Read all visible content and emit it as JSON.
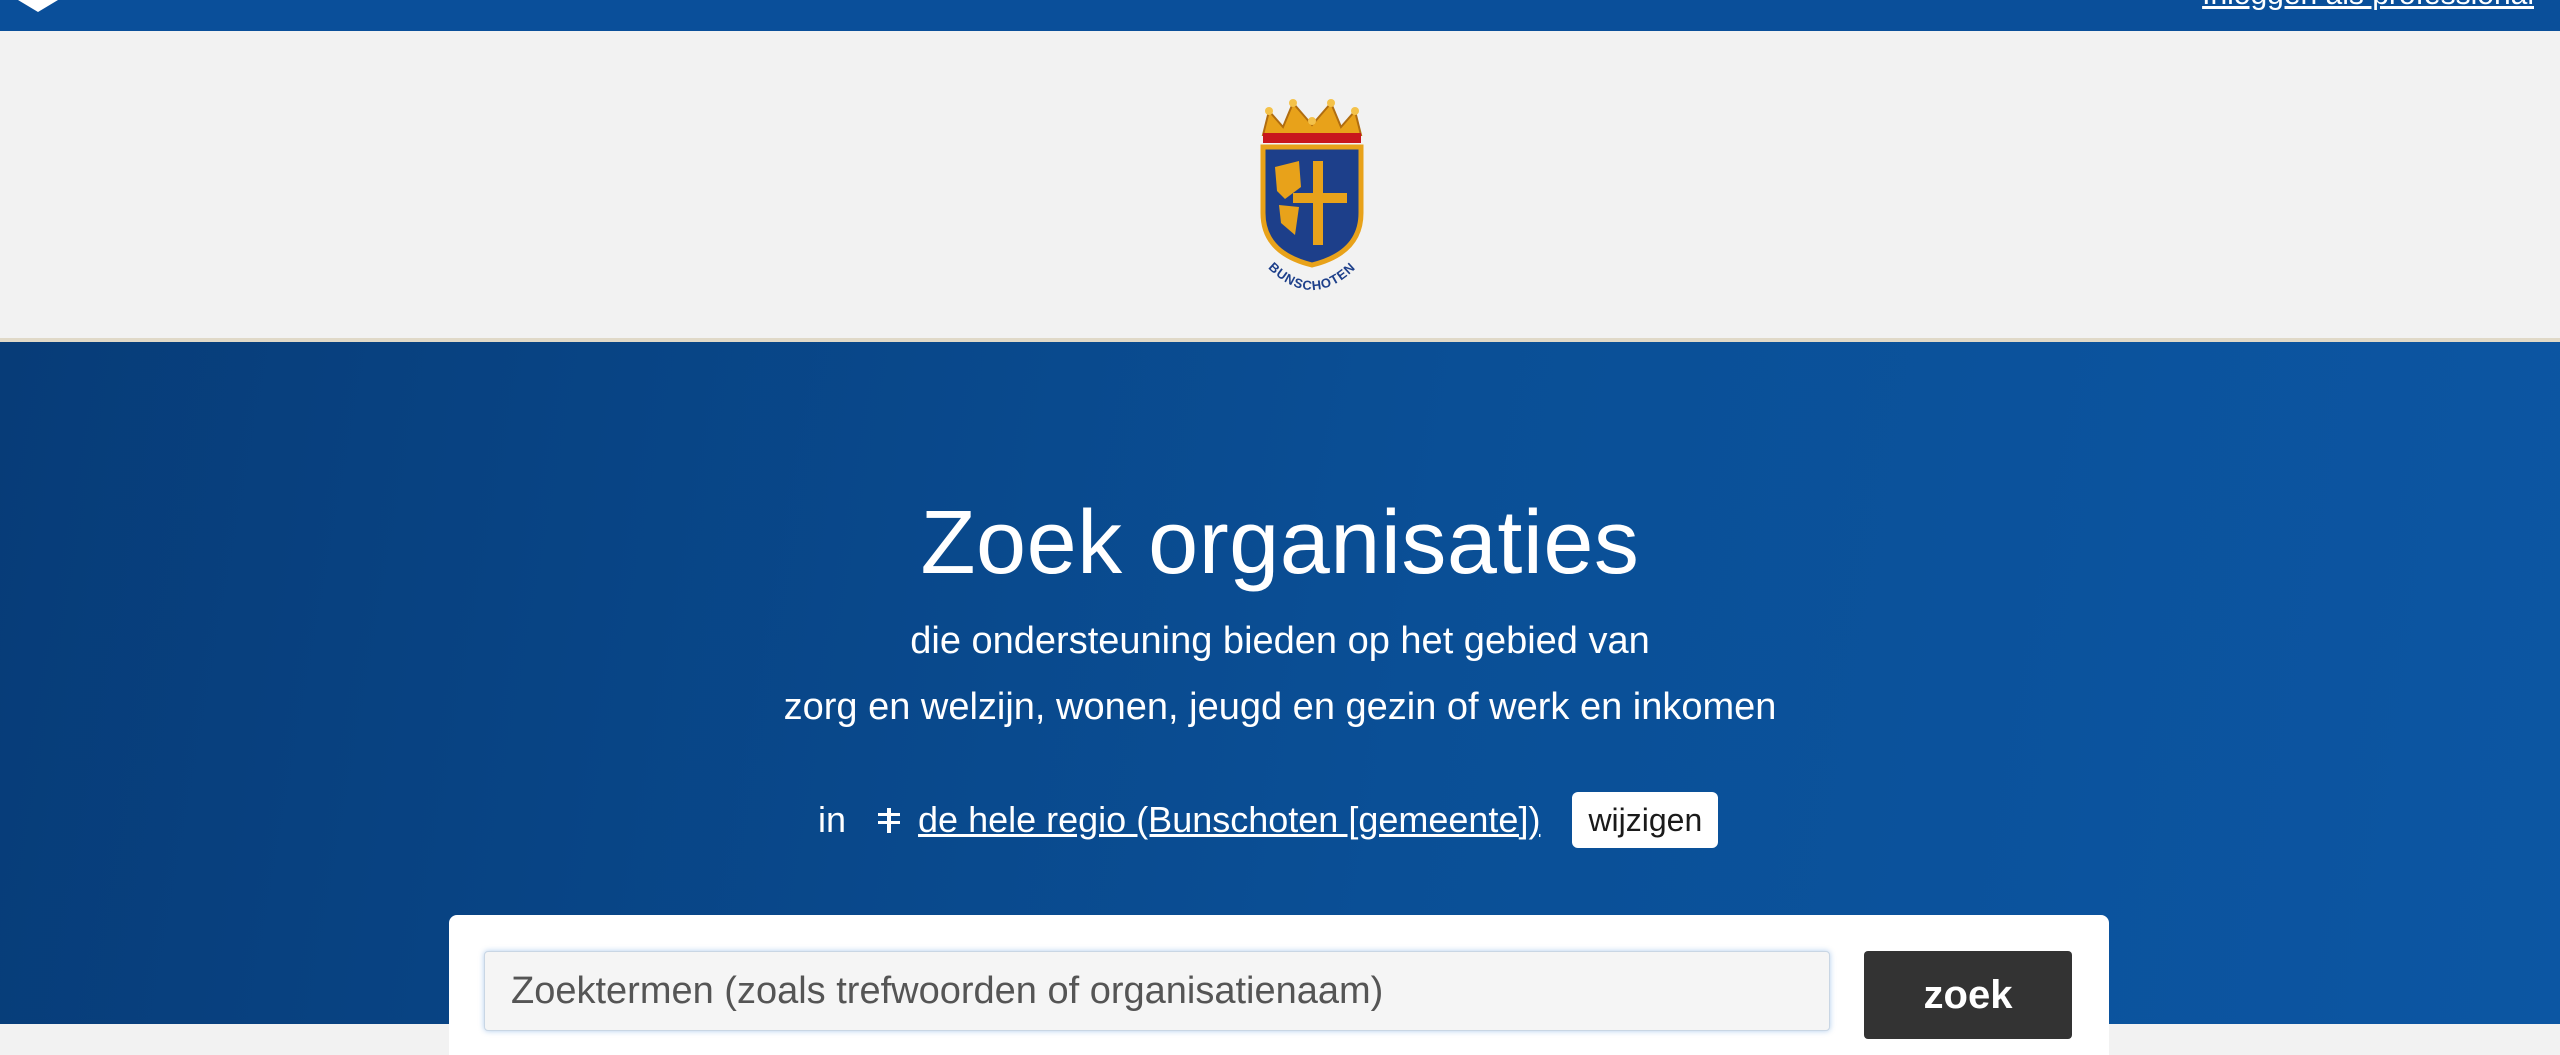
{
  "topbar": {
    "link_label": "Inloggen als professional"
  },
  "logo": {
    "emblem_text": "BUNSCHOTEN"
  },
  "hero": {
    "title": "Zoek organisaties",
    "subtitle_line1": "die ondersteuning bieden op het gebied van",
    "subtitle_line2": "zorg en welzijn, wonen, jeugd en gezin of werk en inkomen",
    "region_prefix": "in",
    "region_link": "de hele regio (Bunschoten [gemeente])",
    "change_label": "wijzigen"
  },
  "search": {
    "placeholder": "Zoektermen (zoals trefwoorden of organisatienaam)",
    "button_label": "zoek"
  },
  "colors": {
    "topbar": "#0a4f9a",
    "hero_start": "#073c78",
    "hero_end": "#0c56a3",
    "search_button": "#333333",
    "emblem_gold": "#e8a21a",
    "emblem_blue": "#1d3f8a"
  }
}
